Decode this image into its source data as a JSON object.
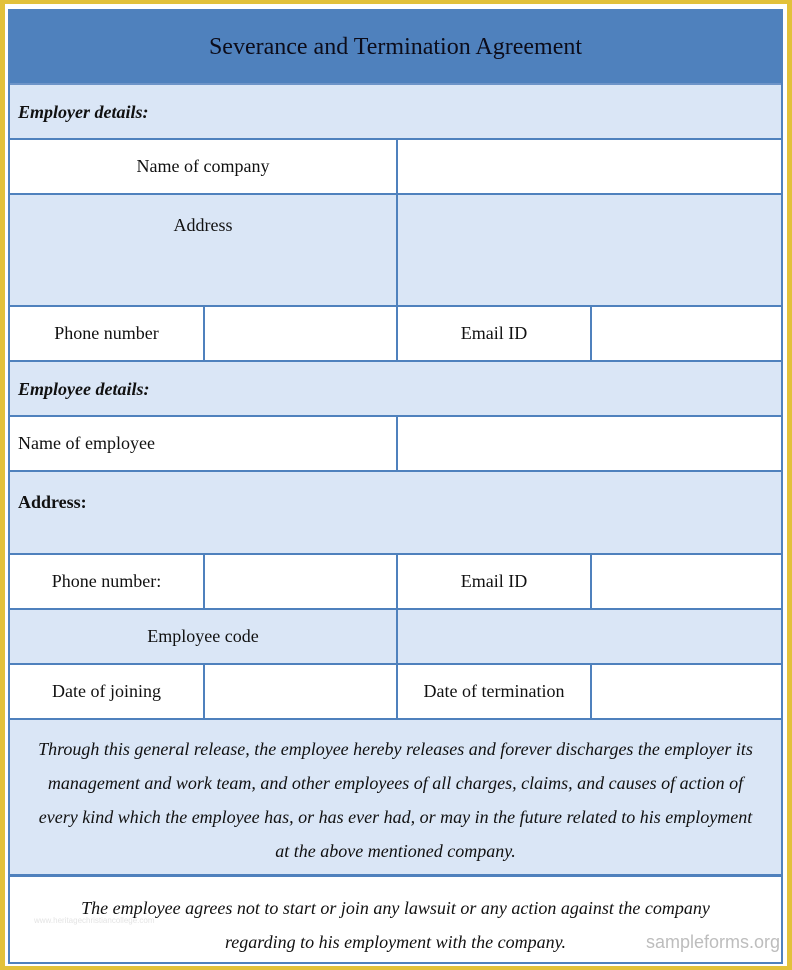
{
  "document": {
    "title": "Severance and Termination Agreement",
    "employer_section": {
      "heading": "Employer details:",
      "name_label": "Name of company",
      "name_value": "",
      "address_label": "Address",
      "address_value": "",
      "phone_label": "Phone number",
      "phone_value": "",
      "email_label": "Email ID",
      "email_value": ""
    },
    "employee_section": {
      "heading": "Employee details:",
      "name_label": "Name of employee",
      "name_value": "",
      "address_label": "Address:",
      "phone_label": "Phone number:",
      "phone_value": "",
      "email_label": "Email ID",
      "email_value": "",
      "code_label": "Employee code",
      "code_value": "",
      "joining_label": "Date of joining",
      "joining_value": "",
      "termination_label": "Date of termination",
      "termination_value": ""
    },
    "release_paragraph": "Through this general release, the employee hereby releases and forever discharges the employer its management and work team, and other employees of all charges, claims, and causes of action of every kind which the employee has, or has ever had, or may in the future related to his employment at the above mentioned company.",
    "agreement_paragraph": "The employee agrees not to start or join any lawsuit or any action against the company regarding to his employment with the company."
  },
  "watermarks": {
    "left": "www.heritagechristiancollege.com",
    "right": "sampleforms.org"
  },
  "colors": {
    "header_blue": "#4f81bd",
    "light_blue": "#dae6f6",
    "frame_yellow": "#e2c13a"
  }
}
